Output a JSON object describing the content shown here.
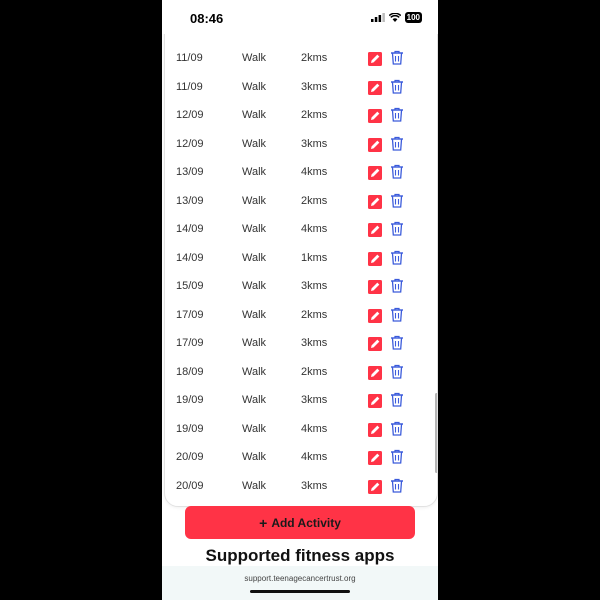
{
  "status_bar": {
    "time": "08:46",
    "battery": "100"
  },
  "activities": [
    {
      "date": "11/09",
      "activity": "Walk",
      "distance": "2kms"
    },
    {
      "date": "11/09",
      "activity": "Walk",
      "distance": "3kms"
    },
    {
      "date": "12/09",
      "activity": "Walk",
      "distance": "2kms"
    },
    {
      "date": "12/09",
      "activity": "Walk",
      "distance": "3kms"
    },
    {
      "date": "13/09",
      "activity": "Walk",
      "distance": "4kms"
    },
    {
      "date": "13/09",
      "activity": "Walk",
      "distance": "2kms"
    },
    {
      "date": "14/09",
      "activity": "Walk",
      "distance": "4kms"
    },
    {
      "date": "14/09",
      "activity": "Walk",
      "distance": "1kms"
    },
    {
      "date": "15/09",
      "activity": "Walk",
      "distance": "3kms"
    },
    {
      "date": "17/09",
      "activity": "Walk",
      "distance": "2kms"
    },
    {
      "date": "17/09",
      "activity": "Walk",
      "distance": "3kms"
    },
    {
      "date": "18/09",
      "activity": "Walk",
      "distance": "2kms"
    },
    {
      "date": "19/09",
      "activity": "Walk",
      "distance": "3kms"
    },
    {
      "date": "19/09",
      "activity": "Walk",
      "distance": "4kms"
    },
    {
      "date": "20/09",
      "activity": "Walk",
      "distance": "4kms"
    },
    {
      "date": "20/09",
      "activity": "Walk",
      "distance": "3kms"
    }
  ],
  "icons": {
    "edit": "edit-icon",
    "delete": "trash-icon"
  },
  "add_button": {
    "label": "Add Activity"
  },
  "section_title": "Supported fitness apps",
  "url": "support.teenagecancertrust.org",
  "colors": {
    "accent": "#ff3346",
    "delete_icon": "#3b5bdb"
  }
}
